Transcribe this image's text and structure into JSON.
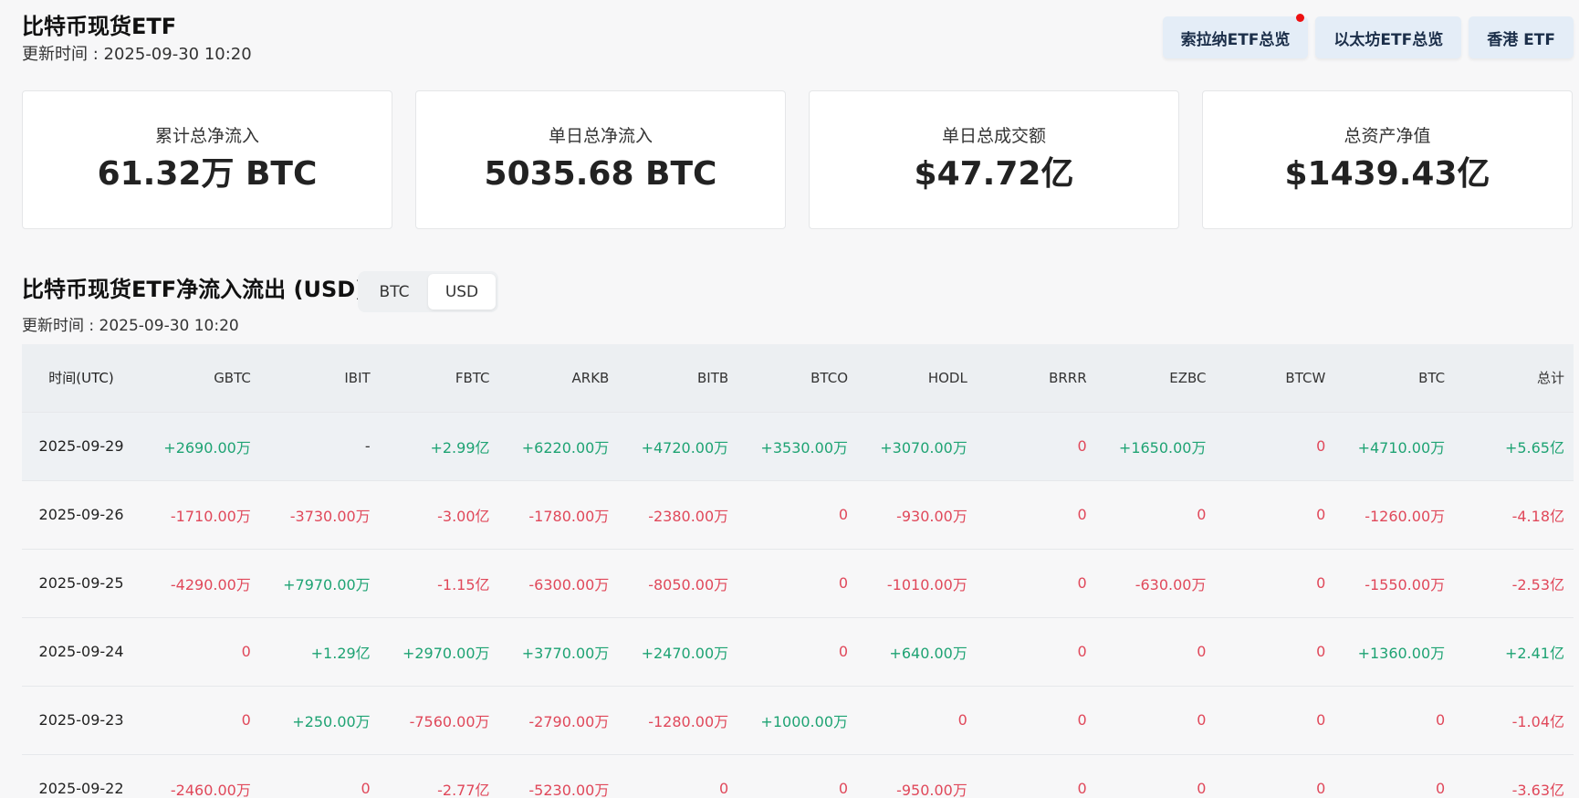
{
  "header": {
    "title": "比特币现货ETF",
    "update_time": "更新时间 : 2025-09-30 10:20"
  },
  "top_buttons": [
    {
      "label": "索拉纳ETF总览",
      "has_dot": true
    },
    {
      "label": "以太坊ETF总览",
      "has_dot": false
    },
    {
      "label": "香港 ETF",
      "has_dot": false
    }
  ],
  "colors": {
    "positive": "#1ea373",
    "negative": "#e0485a",
    "dot": "#ee1111"
  },
  "cards": [
    {
      "label": "累计总净流入",
      "value": "61.32万 BTC"
    },
    {
      "label": "单日总净流入",
      "value": "5035.68 BTC"
    },
    {
      "label": "单日总成交额",
      "value": "$47.72亿"
    },
    {
      "label": "总资产净值",
      "value": "$1439.43亿"
    }
  ],
  "section": {
    "title": "比特币现货ETF净流入流出 (USD)",
    "update_time": "更新时间 : 2025-09-30 10:20",
    "toggle": {
      "options": [
        "BTC",
        "USD"
      ],
      "active": "USD"
    }
  },
  "table": {
    "columns": [
      "时间(UTC)",
      "GBTC",
      "IBIT",
      "FBTC",
      "ARKB",
      "BITB",
      "BTCO",
      "HODL",
      "BRRR",
      "EZBC",
      "BTCW",
      "BTC",
      "总计"
    ],
    "rows": [
      {
        "highlight": true,
        "cells": [
          "2025-09-29",
          "+2690.00万",
          "-",
          "+2.99亿",
          "+6220.00万",
          "+4720.00万",
          "+3530.00万",
          "+3070.00万",
          "0",
          "+1650.00万",
          "0",
          "+4710.00万",
          "+5.65亿"
        ]
      },
      {
        "highlight": false,
        "cells": [
          "2025-09-26",
          "-1710.00万",
          "-3730.00万",
          "-3.00亿",
          "-1780.00万",
          "-2380.00万",
          "0",
          "-930.00万",
          "0",
          "0",
          "0",
          "-1260.00万",
          "-4.18亿"
        ]
      },
      {
        "highlight": false,
        "cells": [
          "2025-09-25",
          "-4290.00万",
          "+7970.00万",
          "-1.15亿",
          "-6300.00万",
          "-8050.00万",
          "0",
          "-1010.00万",
          "0",
          "-630.00万",
          "0",
          "-1550.00万",
          "-2.53亿"
        ]
      },
      {
        "highlight": false,
        "cells": [
          "2025-09-24",
          "0",
          "+1.29亿",
          "+2970.00万",
          "+3770.00万",
          "+2470.00万",
          "0",
          "+640.00万",
          "0",
          "0",
          "0",
          "+1360.00万",
          "+2.41亿"
        ]
      },
      {
        "highlight": false,
        "cells": [
          "2025-09-23",
          "0",
          "+250.00万",
          "-7560.00万",
          "-2790.00万",
          "-1280.00万",
          "+1000.00万",
          "0",
          "0",
          "0",
          "0",
          "0",
          "-1.04亿"
        ]
      },
      {
        "highlight": false,
        "cells": [
          "2025-09-22",
          "-2460.00万",
          "0",
          "-2.77亿",
          "-5230.00万",
          "0",
          "0",
          "-950.00万",
          "0",
          "0",
          "0",
          "0",
          "-3.63亿"
        ]
      }
    ]
  }
}
